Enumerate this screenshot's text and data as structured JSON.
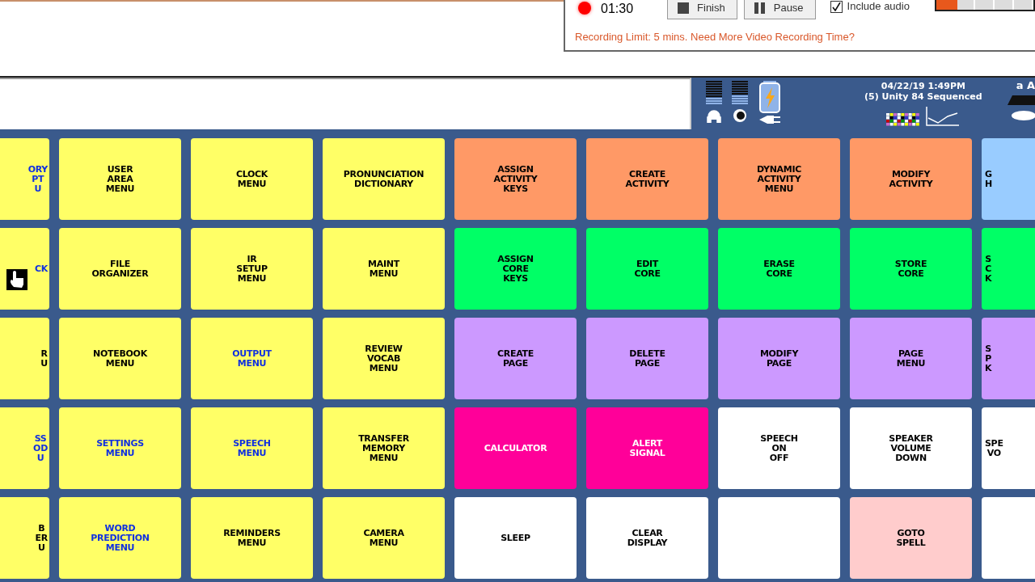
{
  "recorder": {
    "recording": true,
    "time": "01:30",
    "buttons": [
      {
        "label": "Finish",
        "kind": "stop"
      },
      {
        "label": "Pause",
        "kind": "pause"
      }
    ],
    "include_audio": {
      "label": "Include audio",
      "checked": true
    },
    "audio_meter": {
      "level": 0.22
    },
    "limit_notice": "Recording Limit: 5 mins. Need More Video Recording Time?"
  },
  "status": {
    "datetime": "04/22/19 1:49PM",
    "vocabulary": "(5) Unity 84 Sequenced",
    "font_label": "a A"
  },
  "grid": {
    "rows": [
      {
        "cells": [
          {
            "label": "ORY\nPT\nU",
            "color": "#ffff66",
            "kind": "link"
          },
          {
            "label": "USER\nAREA\nMENU",
            "color": "#ffff66",
            "kind": "plain"
          },
          {
            "label": "CLOCK\nMENU",
            "color": "#ffff66",
            "kind": "plain"
          },
          {
            "label": "PRONUNCIATION\nDICTIONARY",
            "color": "#ffff66",
            "kind": "plain"
          },
          {
            "label": "ASSIGN\nACTIVITY\nKEYS",
            "color": "#ff9966",
            "kind": "plain"
          },
          {
            "label": "CREATE\nACTIVITY",
            "color": "#ff9966",
            "kind": "plain"
          },
          {
            "label": "DYNAMIC\nACTIVITY\nMENU",
            "color": "#ff9966",
            "kind": "plain"
          },
          {
            "label": "MODIFY\nACTIVITY",
            "color": "#ff9966",
            "kind": "plain"
          },
          {
            "label": "G\nH",
            "color": "#99ccff",
            "kind": "plain"
          }
        ]
      },
      {
        "cells": [
          {
            "label": "CK",
            "color": "#ffff66",
            "kind": "link"
          },
          {
            "label": "FILE\nORGANIZER",
            "color": "#ffff66",
            "kind": "plain"
          },
          {
            "label": "IR\nSETUP\nMENU",
            "color": "#ffff66",
            "kind": "plain"
          },
          {
            "label": "MAINT\nMENU",
            "color": "#ffff66",
            "kind": "plain"
          },
          {
            "label": "ASSIGN\nCORE\nKEYS",
            "color": "#00ff66",
            "kind": "plain"
          },
          {
            "label": "EDIT\nCORE",
            "color": "#00ff66",
            "kind": "plain"
          },
          {
            "label": "ERASE\nCORE",
            "color": "#00ff66",
            "kind": "plain"
          },
          {
            "label": "STORE\nCORE",
            "color": "#00ff66",
            "kind": "plain"
          },
          {
            "label": "S\nC\nK",
            "color": "#00ff66",
            "kind": "plain"
          }
        ]
      },
      {
        "cells": [
          {
            "label": "R\nU",
            "color": "#ffff66",
            "kind": "plain"
          },
          {
            "label": "NOTEBOOK\nMENU",
            "color": "#ffff66",
            "kind": "plain"
          },
          {
            "label": "OUTPUT\nMENU",
            "color": "#ffff66",
            "kind": "link"
          },
          {
            "label": "REVIEW\nVOCAB\nMENU",
            "color": "#ffff66",
            "kind": "plain"
          },
          {
            "label": "CREATE\nPAGE",
            "color": "#cc99ff",
            "kind": "plain"
          },
          {
            "label": "DELETE\nPAGE",
            "color": "#cc99ff",
            "kind": "plain"
          },
          {
            "label": "MODIFY\nPAGE",
            "color": "#cc99ff",
            "kind": "plain"
          },
          {
            "label": "PAGE\nMENU",
            "color": "#cc99ff",
            "kind": "plain"
          },
          {
            "label": "S\nP\nK",
            "color": "#cc99ff",
            "kind": "plain"
          }
        ]
      },
      {
        "cells": [
          {
            "label": "SS\nOD\nU",
            "color": "#ffff66",
            "kind": "link"
          },
          {
            "label": "SETTINGS\nMENU",
            "color": "#ffff66",
            "kind": "link"
          },
          {
            "label": "SPEECH\nMENU",
            "color": "#ffff66",
            "kind": "link"
          },
          {
            "label": "TRANSFER\nMEMORY\nMENU",
            "color": "#ffff66",
            "kind": "plain"
          },
          {
            "label": "CALCULATOR",
            "color": "#ff0099",
            "kind": "inverse"
          },
          {
            "label": "ALERT\nSIGNAL",
            "color": "#ff0099",
            "kind": "inverse"
          },
          {
            "label": "SPEECH\nON\nOFF",
            "color": "#ffffff",
            "kind": "plain"
          },
          {
            "label": "SPEAKER\nVOLUME\nDOWN",
            "color": "#ffffff",
            "kind": "plain"
          },
          {
            "label": "SPE\nVO",
            "color": "#ffffff",
            "kind": "plain"
          }
        ]
      },
      {
        "cells": [
          {
            "label": "B\nER\nU",
            "color": "#ffff66",
            "kind": "plain"
          },
          {
            "label": "WORD\nPREDICTION\nMENU",
            "color": "#ffff66",
            "kind": "link"
          },
          {
            "label": "REMINDERS\nMENU",
            "color": "#ffff66",
            "kind": "plain"
          },
          {
            "label": "CAMERA\nMENU",
            "color": "#ffff66",
            "kind": "plain"
          },
          {
            "label": "SLEEP",
            "color": "#ffffff",
            "kind": "plain"
          },
          {
            "label": "CLEAR\nDISPLAY",
            "color": "#ffffff",
            "kind": "plain"
          },
          {
            "color": "#ffffff",
            "kind": "plain"
          },
          {
            "label": "GOTO\nSPELL",
            "color": "#ffcccc",
            "kind": "plain"
          },
          {
            "color": "#ffffff",
            "kind": "plain"
          }
        ]
      }
    ]
  }
}
